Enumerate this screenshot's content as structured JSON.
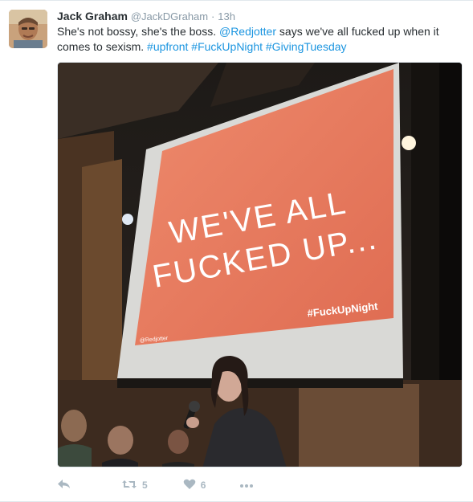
{
  "tweet": {
    "author": {
      "name": "Jack Graham",
      "handle": "@JackDGraham",
      "separator": "·",
      "time": "13h",
      "avatar_icon": "profile-photo"
    },
    "text_parts": {
      "p1": "She's not bossy, she's the boss. ",
      "mention": "@Redjotter",
      "p2": " says we've all fucked up when it comes to sexism. ",
      "tag1": "#upfront",
      "tag2": "#FuckUpNight",
      "tag3": "#GivingTuesday"
    },
    "media": {
      "slide_line1": "WE'VE ALL",
      "slide_line2": "FUCKED UP...",
      "slide_hashtag": "#FuckUpNight",
      "slide_handle": "@Redjotter"
    },
    "actions": {
      "reply_icon": "reply-icon",
      "retweet_icon": "retweet-icon",
      "retweet_count": "5",
      "like_icon": "heart-icon",
      "like_count": "6",
      "more_icon": "more-icon"
    },
    "colors": {
      "link": "#1b95e0",
      "muted": "#8899a6",
      "action": "#aab8c2",
      "slide": "#e8785d"
    }
  }
}
